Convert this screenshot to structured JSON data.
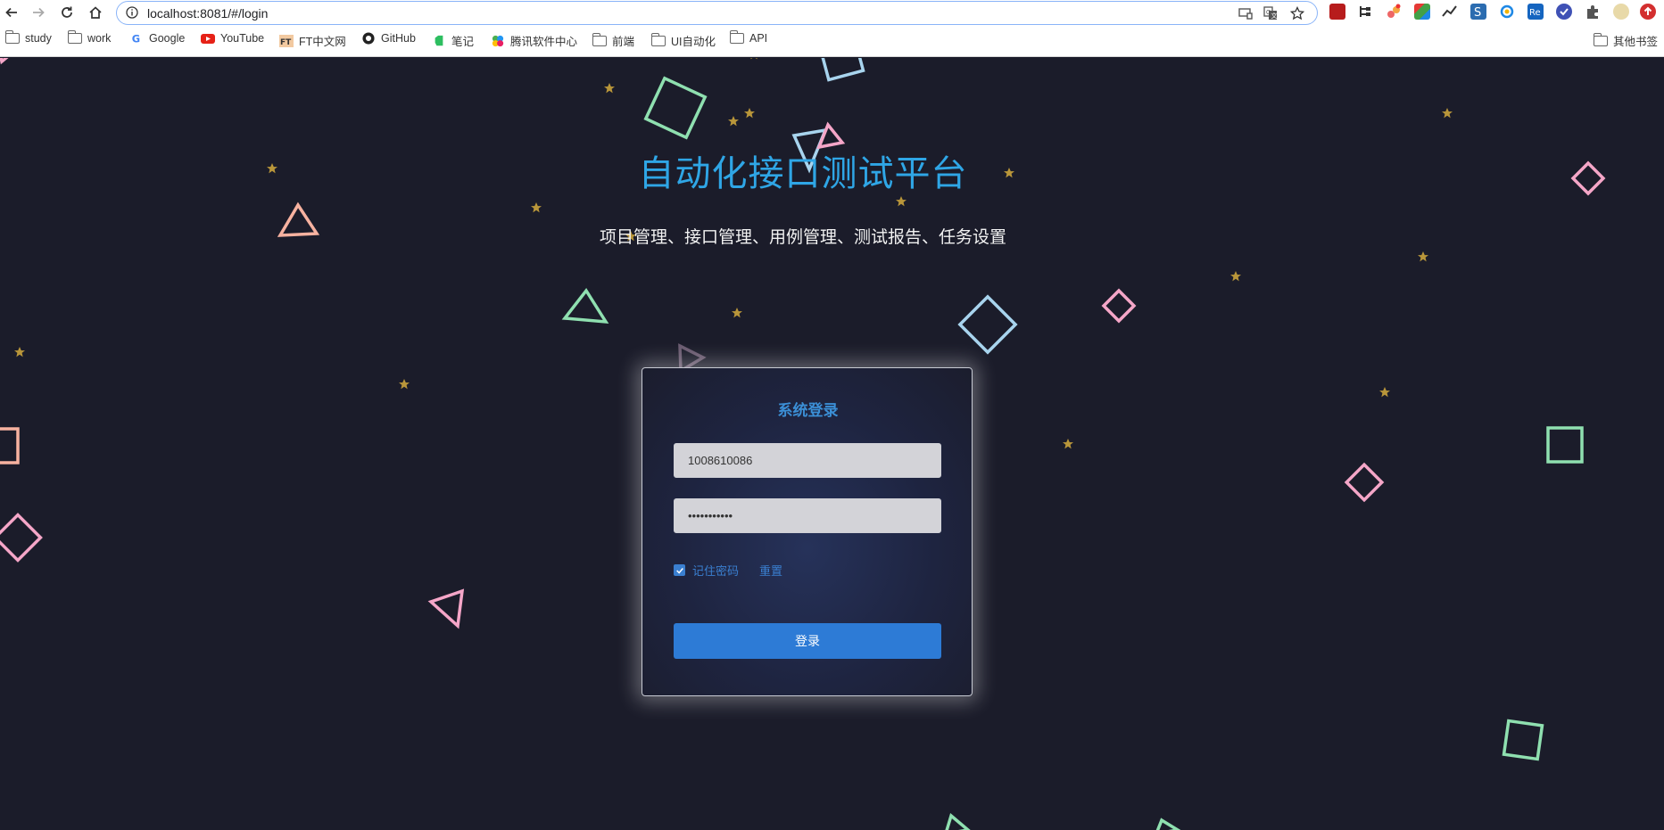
{
  "browser": {
    "url": "localhost:8081/#/login",
    "bookmarks": [
      {
        "label": "study",
        "icon": "folder-icon"
      },
      {
        "label": "work",
        "icon": "folder-icon"
      },
      {
        "label": "Google",
        "icon": "google-icon"
      },
      {
        "label": "YouTube",
        "icon": "youtube-icon"
      },
      {
        "label": "FT中文网",
        "icon": "ft-icon"
      },
      {
        "label": "GitHub",
        "icon": "github-icon"
      },
      {
        "label": "笔记",
        "icon": "evernote-icon"
      },
      {
        "label": "腾讯软件中心",
        "icon": "tencent-icon"
      },
      {
        "label": "前端",
        "icon": "folder-icon"
      },
      {
        "label": "UI自动化",
        "icon": "folder-icon"
      },
      {
        "label": "API",
        "icon": "folder-icon"
      }
    ],
    "other_bookmarks": "其他书签"
  },
  "page": {
    "title": "自动化接口测试平台",
    "subtitle": "项目管理、接口管理、用例管理、测试报告、任务设置"
  },
  "login": {
    "title": "系统登录",
    "username_value": "1008610086",
    "password_value": "•••••••••••",
    "remember_label": "记住密码",
    "remember_checked": true,
    "reset_label": "重置",
    "submit_label": "登录"
  },
  "colors": {
    "background": "#1b1c2a",
    "title": "#2fa6e6",
    "accent": "#2d7bd6",
    "star": "#b9963a"
  }
}
